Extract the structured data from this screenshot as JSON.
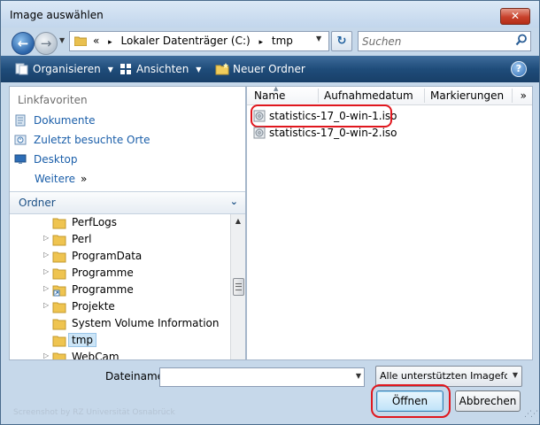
{
  "window": {
    "title": "Image auswählen",
    "close_glyph": "✕"
  },
  "nav": {
    "breadcrumb_overflow": "«",
    "breadcrumb": [
      "Lokaler Datenträger (C:)",
      "tmp"
    ],
    "breadcrumb_separator": "▸",
    "search_placeholder": "Suchen"
  },
  "toolbar": {
    "organize": "Organisieren",
    "views": "Ansichten",
    "new_folder": "Neuer Ordner",
    "help": "?"
  },
  "sidebar": {
    "favorites_header": "Linkfavoriten",
    "favorites": [
      {
        "label": "Dokumente",
        "icon": "documents-icon"
      },
      {
        "label": "Zuletzt besuchte Orte",
        "icon": "recent-places-icon"
      },
      {
        "label": "Desktop",
        "icon": "desktop-icon"
      }
    ],
    "more": "Weitere",
    "more_glyph": "»",
    "folders_header": "Ordner",
    "tree": [
      {
        "label": "PerfLogs",
        "expandable": false,
        "icon": "folder-icon"
      },
      {
        "label": "Perl",
        "expandable": true,
        "icon": "folder-icon"
      },
      {
        "label": "ProgramData",
        "expandable": true,
        "icon": "folder-icon"
      },
      {
        "label": "Programme",
        "expandable": true,
        "icon": "folder-icon"
      },
      {
        "label": "Programme",
        "expandable": true,
        "icon": "folder-shortcut-icon"
      },
      {
        "label": "Projekte",
        "expandable": true,
        "icon": "folder-icon"
      },
      {
        "label": "System Volume Information",
        "expandable": false,
        "icon": "folder-icon"
      },
      {
        "label": "tmp",
        "expandable": false,
        "icon": "folder-icon",
        "selected": true
      },
      {
        "label": "WebCam",
        "expandable": true,
        "icon": "folder-icon"
      }
    ]
  },
  "filelist": {
    "columns": [
      "Name",
      "Aufnahmedatum",
      "Markierungen"
    ],
    "columns_more": "»",
    "files": [
      {
        "name": "statistics-17_0-win-1.iso",
        "icon": "disc-image-icon",
        "highlighted": true
      },
      {
        "name": "statistics-17_0-win-2.iso",
        "icon": "disc-image-icon"
      }
    ]
  },
  "footer": {
    "filename_label": "Dateiname:",
    "filename_value": "",
    "filter_value": "Alle unterstützten Imageformate",
    "open_button": "Öffnen",
    "cancel_button": "Abbrechen",
    "watermark": "Screenshot by RZ Universität Osnabrück"
  },
  "colors": {
    "highlight_ring": "#e0171e",
    "link": "#1a5ea9",
    "toolbar": "#1f4c7a"
  }
}
